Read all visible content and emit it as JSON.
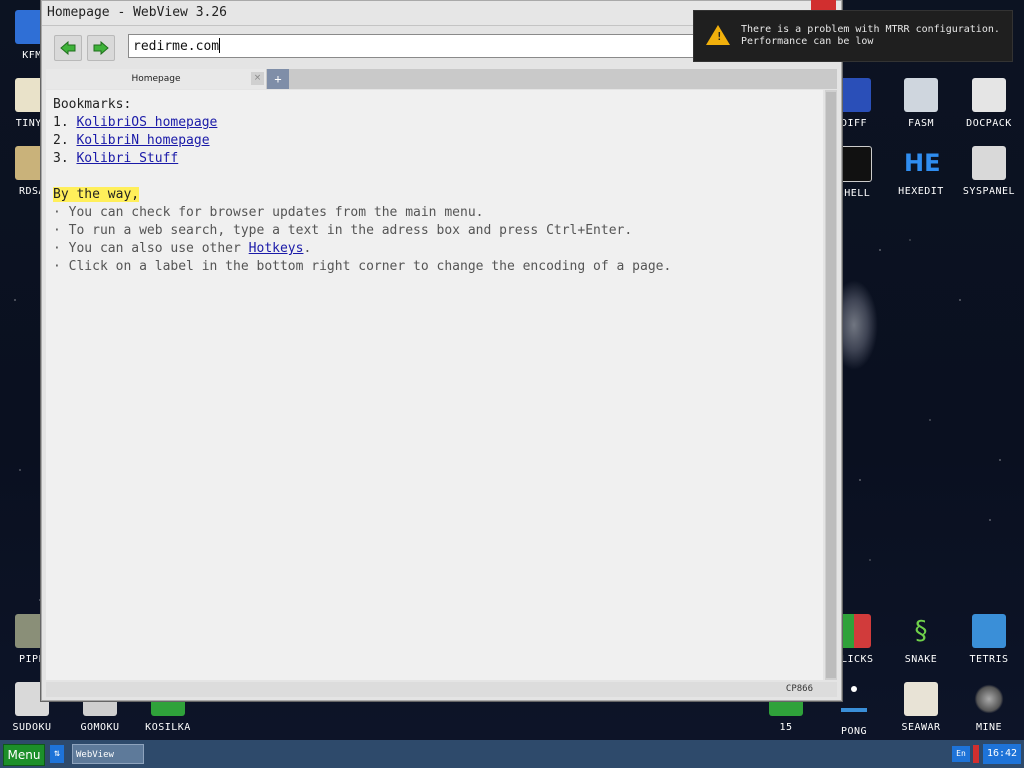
{
  "window": {
    "title": "Homepage - WebView 3.26"
  },
  "toolbar": {
    "url": "redirme.com"
  },
  "tabs": [
    {
      "label": "Homepage",
      "close": "×"
    }
  ],
  "tab_add": "+",
  "page": {
    "bookmarks_title": "Bookmarks:",
    "bookmarks": [
      {
        "num": "1.",
        "label": "KolibriOS homepage"
      },
      {
        "num": "2.",
        "label": "KolibriN homepage"
      },
      {
        "num": "3.",
        "label": "Kolibri Stuff"
      }
    ],
    "by_the_way": "By the way,",
    "tips": [
      "· You can check for browser updates from the main menu.",
      "· To run a web search, type a text in the adress box and press Ctrl+Enter.",
      "· You can also use other ",
      "· Click on a label in the bottom right corner to change the encoding of a page."
    ],
    "hotkeys_link": "Hotkeys",
    "hotkeys_tail": "."
  },
  "status": {
    "encoding": "CP866"
  },
  "notification": {
    "line1": "There is a problem with MTRR configuration.",
    "line2": "Performance can be low"
  },
  "desktop_icons": {
    "left": [
      "KFM",
      "TINYP",
      "RDSA",
      "PIPE",
      "SUDOKU",
      "GOMOKU",
      "KOSILKA"
    ],
    "right": [
      "DIFF",
      "FASM",
      "DOCPACK",
      "SHELL",
      "HEXEDIT",
      "SYSPANEL",
      "CLICKS",
      "SNAKE",
      "TETRIS",
      "15",
      "PONG",
      "SEAWAR",
      "MINE"
    ]
  },
  "taskbar": {
    "menu": "Menu",
    "window_item": "WebView",
    "lang": "En",
    "clock": "16:42"
  },
  "colors": {
    "accent": "#1e73d8",
    "menu_green": "#1c8f2a",
    "highlight": "#ffef5a",
    "link": "#1a1aa8"
  }
}
